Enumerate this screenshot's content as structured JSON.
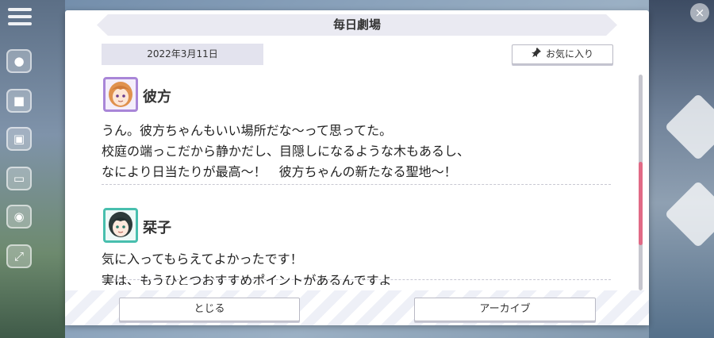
{
  "dialog": {
    "title": "毎日劇場",
    "date": "2022年3月11日",
    "favorite_label": "お気に入り",
    "entries": [
      {
        "speaker": "彼方",
        "lines": [
          "うん。彼方ちゃんもいい場所だな〜って思ってた。",
          "校庭の端っこだから静かだし、目隠しになるような木もあるし、",
          "なにより日当たりが最高〜！　彼方ちゃんの新たなる聖地〜！"
        ]
      },
      {
        "speaker": "栞子",
        "lines": [
          "気に入ってもらえてよかったです！",
          "実は、もうひとつおすすめポイントがあるんですよ"
        ]
      }
    ],
    "close_label": "とじる",
    "archive_label": "アーカイブ"
  },
  "colors": {
    "scroll_thumb": "#e16a86",
    "avatar_kanata_frame": "#a986d8",
    "avatar_shioriko_frame": "#48bfae"
  },
  "icons": [
    "menu-icon",
    "pin-icon",
    "close-icon"
  ]
}
